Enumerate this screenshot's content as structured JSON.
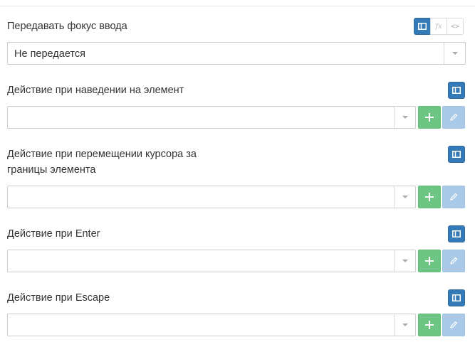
{
  "fields": [
    {
      "label": "Передавать фокус ввода",
      "value": "Не передается",
      "modes": [
        "value-mode-icon",
        "formula-icon",
        "code-icon"
      ],
      "active_mode": "value-mode-icon",
      "buttons": []
    },
    {
      "label": "Действие при наведении на элемент",
      "value": "",
      "modes": [
        "value-mode-icon"
      ],
      "active_mode": "value-mode-icon",
      "buttons": [
        "add",
        "edit"
      ]
    },
    {
      "label_line1": "Действие при перемещении курсора за",
      "label_line2": "границы элемента",
      "value": "",
      "modes": [
        "value-mode-icon"
      ],
      "active_mode": "value-mode-icon",
      "buttons": [
        "add",
        "edit"
      ]
    },
    {
      "label": "Действие при Enter",
      "value": "",
      "modes": [
        "value-mode-icon"
      ],
      "active_mode": "value-mode-icon",
      "buttons": [
        "add",
        "edit"
      ]
    },
    {
      "label": "Действие при Escape",
      "value": "",
      "modes": [
        "value-mode-icon"
      ],
      "active_mode": "value-mode-icon",
      "buttons": [
        "add",
        "edit"
      ]
    }
  ],
  "icons": {
    "add": "plus-icon",
    "edit": "pencil-icon",
    "formula_glyph": "fx",
    "code_glyph": "<>"
  },
  "colors": {
    "active_mode": "#337ab7",
    "add_button": "#6cc582",
    "edit_button": "#a9c9e6"
  }
}
